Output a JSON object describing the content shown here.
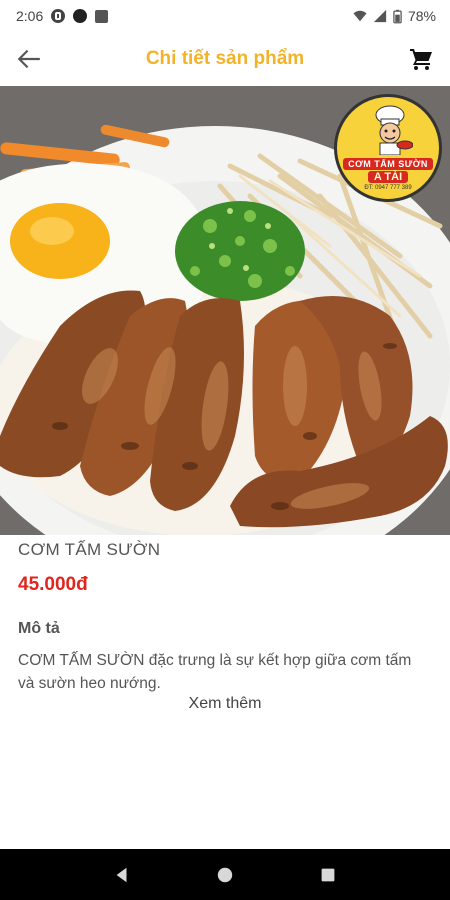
{
  "status_bar": {
    "time": "2:06",
    "battery": "78%",
    "icons": [
      "notification-icon",
      "record-icon",
      "square-app-icon",
      "wifi-icon",
      "signal-icon",
      "battery-icon"
    ]
  },
  "app_bar": {
    "title": "Chi tiết sản phẩm",
    "back_icon": "arrow-left-icon",
    "cart_icon": "cart-icon"
  },
  "logo": {
    "brand": "CƠM TẤM SƯỜN",
    "name": "A TÀI",
    "phone": "ĐT: 0947 777 389"
  },
  "product": {
    "name": "CƠM TẤM SƯỜN",
    "price": "45.000đ",
    "description_heading": "Mô tả",
    "description": "CƠM TẤM SƯỜN đặc trưng là sự kết hợp giữa cơm tấm và sườn heo nướng.",
    "see_more": "Xem thêm"
  },
  "colors": {
    "title_yellow": "#f2b32b",
    "price_red": "#e0261f",
    "text_gray": "#555555"
  },
  "nav_bar": {
    "icons": [
      "back-triangle-icon",
      "home-circle-icon",
      "recents-square-icon"
    ]
  }
}
